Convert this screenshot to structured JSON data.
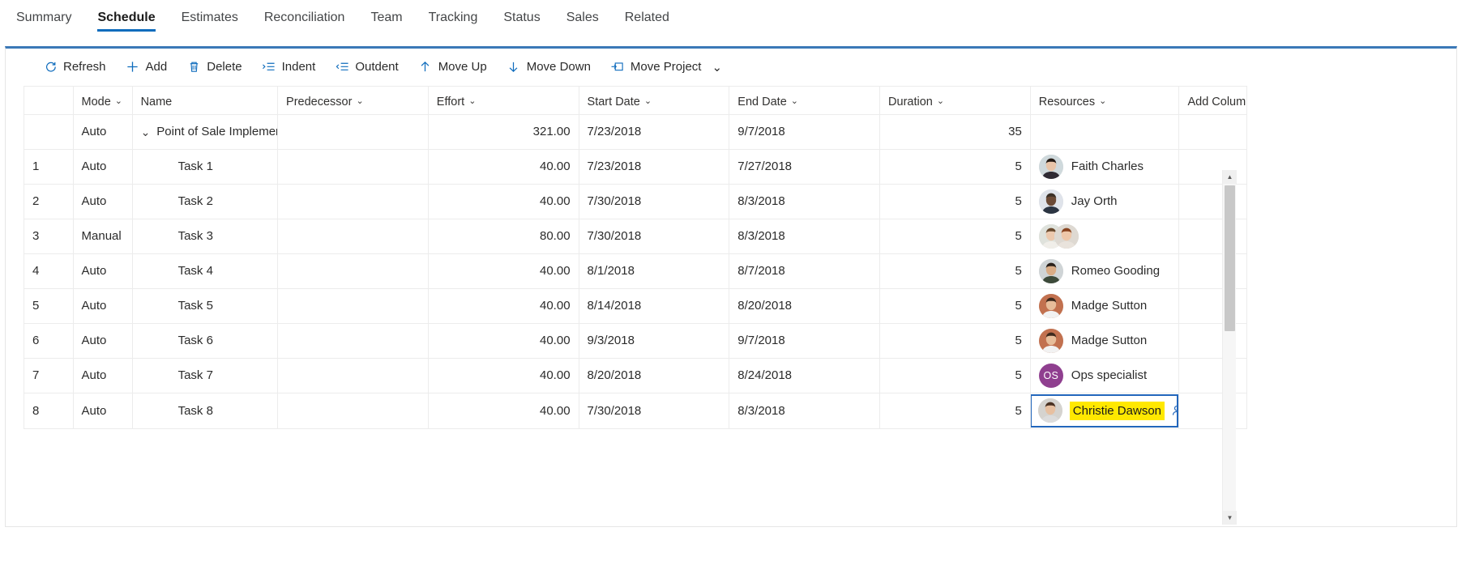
{
  "tabs": [
    {
      "label": "Summary",
      "active": false
    },
    {
      "label": "Schedule",
      "active": true
    },
    {
      "label": "Estimates",
      "active": false
    },
    {
      "label": "Reconciliation",
      "active": false
    },
    {
      "label": "Team",
      "active": false
    },
    {
      "label": "Tracking",
      "active": false
    },
    {
      "label": "Status",
      "active": false
    },
    {
      "label": "Sales",
      "active": false
    },
    {
      "label": "Related",
      "active": false
    }
  ],
  "toolbar": {
    "refresh": "Refresh",
    "add": "Add",
    "delete": "Delete",
    "indent": "Indent",
    "outdent": "Outdent",
    "move_up": "Move Up",
    "move_down": "Move Down",
    "move_project": "Move Project",
    "move_project_caret": "⌄"
  },
  "grid": {
    "columns": [
      {
        "key": "rowno",
        "label": "",
        "menu": false
      },
      {
        "key": "mode",
        "label": "Mode",
        "menu": true
      },
      {
        "key": "name",
        "label": "Name",
        "menu": false
      },
      {
        "key": "predecessor",
        "label": "Predecessor",
        "menu": true
      },
      {
        "key": "effort",
        "label": "Effort",
        "menu": true
      },
      {
        "key": "start",
        "label": "Start Date",
        "menu": true
      },
      {
        "key": "end",
        "label": "End Date",
        "menu": true
      },
      {
        "key": "duration",
        "label": "Duration",
        "menu": true
      },
      {
        "key": "resources",
        "label": "Resources",
        "menu": true
      },
      {
        "key": "addcol",
        "label": "Add Column",
        "menu": true
      }
    ],
    "chevron": "⌄",
    "summary_row": {
      "rowno": "",
      "mode": "Auto",
      "name": "Point of Sale Implementat",
      "twisty": "⌄",
      "predecessor": "",
      "effort": "321.00",
      "start": "7/23/2018",
      "end": "9/7/2018",
      "duration": "35",
      "resources": []
    },
    "rows": [
      {
        "rowno": "1",
        "mode": "Auto",
        "name": "Task 1",
        "predecessor": "",
        "effort": "40.00",
        "start": "7/23/2018",
        "end": "7/27/2018",
        "duration": "5",
        "resources": [
          {
            "name": "Faith Charles",
            "avatar": "photo-female-1"
          }
        ]
      },
      {
        "rowno": "2",
        "mode": "Auto",
        "name": "Task 2",
        "predecessor": "",
        "effort": "40.00",
        "start": "7/30/2018",
        "end": "8/3/2018",
        "duration": "5",
        "resources": [
          {
            "name": "Jay Orth",
            "avatar": "photo-male-1"
          }
        ]
      },
      {
        "rowno": "3",
        "mode": "Manual",
        "name": "Task 3",
        "predecessor": "",
        "effort": "80.00",
        "start": "7/30/2018",
        "end": "8/3/2018",
        "duration": "5",
        "resources": [
          {
            "name": "",
            "avatar": "photo-female-2"
          },
          {
            "name": "",
            "avatar": "photo-female-3"
          }
        ]
      },
      {
        "rowno": "4",
        "mode": "Auto",
        "name": "Task 4",
        "predecessor": "",
        "effort": "40.00",
        "start": "8/1/2018",
        "end": "8/7/2018",
        "duration": "5",
        "resources": [
          {
            "name": "Romeo Gooding",
            "avatar": "photo-male-2"
          }
        ]
      },
      {
        "rowno": "5",
        "mode": "Auto",
        "name": "Task 5",
        "predecessor": "",
        "effort": "40.00",
        "start": "8/14/2018",
        "end": "8/20/2018",
        "duration": "5",
        "resources": [
          {
            "name": "Madge Sutton",
            "avatar": "photo-female-4"
          }
        ]
      },
      {
        "rowno": "6",
        "mode": "Auto",
        "name": "Task 6",
        "predecessor": "",
        "effort": "40.00",
        "start": "9/3/2018",
        "end": "9/7/2018",
        "duration": "5",
        "resources": [
          {
            "name": "Madge Sutton",
            "avatar": "photo-female-4"
          }
        ]
      },
      {
        "rowno": "7",
        "mode": "Auto",
        "name": "Task 7",
        "predecessor": "",
        "effort": "40.00",
        "start": "8/20/2018",
        "end": "8/24/2018",
        "duration": "5",
        "resources": [
          {
            "name": "Ops specialist",
            "avatar": "initials",
            "initials": "OS",
            "color": "#8f3f8f"
          }
        ]
      },
      {
        "rowno": "8",
        "mode": "Auto",
        "name": "Task 8",
        "predecessor": "",
        "effort": "40.00",
        "start": "7/30/2018",
        "end": "8/3/2018",
        "duration": "5",
        "editing": true,
        "resources": [
          {
            "name": "Christie Dawson",
            "avatar": "photo-female-5",
            "highlighted": true
          }
        ]
      }
    ]
  },
  "scrollbar": {
    "up_arrow": "▲",
    "down_arrow": "▼"
  },
  "colors": {
    "accent": "#0f6cbd",
    "tab_underline": "#0f6cbd",
    "card_top_border": "#3b79b7",
    "selection_border": "#2266bb",
    "highlight": "#ffe800",
    "initials_avatar": "#8f3f8f",
    "grid_line": "#ececec"
  }
}
